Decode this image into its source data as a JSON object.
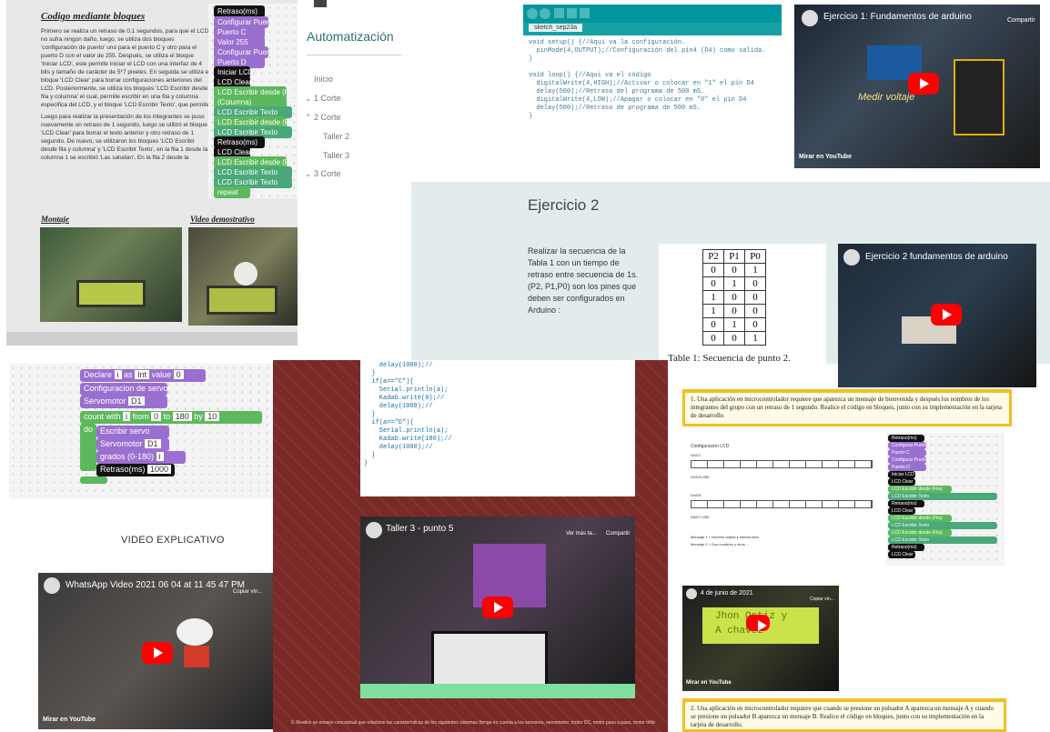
{
  "blocks_top": {
    "heading": "Codigo mediante bloques",
    "paragraph1": "Primero se realiza un retraso de 0,1 segundos, para que el LCD no sufra ningún daño, luego, se utiliza dos bloques 'configuración de puerto' uno para el puerto C y otro para el puerto D con el valor de 255. Después, se utiliza el bloque 'Iniciar LCD', este permite iniciar el LCD con una interfaz de 4 bits y tamaño de carácter de 5*7 pixeles. En seguida se utiliza el bloque 'LCD Clear' para borrar configuraciones anteriores del LCD. Posteriormente, se utiliza los bloques 'LCD Escribir desde fila y columna' el cual, permite escribir en una fila y columna especifica del LCD, y el bloque 'LCD Escribir Texto', que permite escribir texto en el LCD. En la fila 1 desde la columna 1 se escribió 'Hola' y en la fila 2 desde la columna 1 se escribió 'Bienvenidos'.",
    "paragraph2": "Luego para realizar la presentación de los integrantes se puso nuevamente un retraso de 1 segundo, luego se utilizó el bloque 'LCD Clear' para borrar el texto anterior y otro retraso de 1 segundo. De nuevo, se utilizaron los bloques 'LCD Escribir desde fila y columna' y 'LCD Escribir Texto', en la fila 1 desde la columna 1 se escribió 'Las saludan', En la fila 2 desde la columna 1 se escribió 'Darcy Vargas'. Finalmente, se utiliza el bloque de interacciones 'Repeat' y el bloque lógico 'true'.",
    "montaje": "Montaje",
    "video_demo": "Video demostrativo"
  },
  "blocks_small": [
    "Retraso(ms)",
    "Configurar Puerto",
    "Puerto C",
    "Valor 255",
    "Configurar Puerto",
    "Puerto D",
    "Valor",
    "Iniciar LCD",
    "LCD Clear",
    "LCD Escribir desde (Fila)",
    "(Columna)",
    "LCD Escribir Texto",
    "LCD Escribir desde (Fila)",
    "(Columna)",
    "LCD Escribir Texto",
    "Retraso(ms)",
    "LCD Clear",
    "Retraso(ms)",
    "LCD Escribir desde (Fila)",
    "(Columna)",
    "LCD Escribir Texto",
    "LCD Escribir desde (Fila)",
    "(Columna)",
    "LCD Escribir Texto",
    "repeat",
    "do"
  ],
  "automatizacion": {
    "title": "Automatización",
    "menu": [
      "Inicio",
      "1 Corte",
      "2 Corte",
      "Taller 2",
      "Taller 3",
      "3 Corte"
    ]
  },
  "arduino_ide": {
    "tab": "sketch_sep23a",
    "code": "void setup() {//Aqui va la configuración.\n  pinMode(4,OUTPUT);//Configuración del pin4 (D4) como salida.\n}\n\nvoid loop() {//Aqui va el código\n  digitalWrite(4,HIGH);//Activar o colocar en \"1\" el pin D4\n  delay(500);//Retraso del programa de 500 mS.\n  digitalWrite(4,LOW);//Apagar o colocar en \"0\" el pin D4\n  delay(500);//Retraso de programa de 500 mS.\n}"
  },
  "video1": {
    "title": "Ejercicio 1: Fundamentos de arduino",
    "overlay": "Medir voltaje",
    "share": "Compartir",
    "watch": "Mirar en",
    "brand": "YouTube"
  },
  "ejercicio2": {
    "heading": "Ejercicio 2",
    "text": "Realizar la secuencia de la Tabla 1 con un tiempo de retraso entre secuencia de 1s. (P2, P1,P0) son los pines que deben ser configurados en Arduino :",
    "table_headers": [
      "P2",
      "P1",
      "P0"
    ],
    "table_rows": [
      [
        "0",
        "0",
        "1"
      ],
      [
        "0",
        "1",
        "0"
      ],
      [
        "1",
        "0",
        "0"
      ],
      [
        "1",
        "0",
        "0"
      ],
      [
        "0",
        "1",
        "0"
      ],
      [
        "0",
        "0",
        "1"
      ]
    ],
    "caption": "Table 1: Secuencia de punto 2."
  },
  "video2": {
    "title": "Ejercicio 2 fundamentos de arduino"
  },
  "servo_blocks": {
    "declare": "Declare",
    "as": "as",
    "int": "Int",
    "value": "value",
    "zero": "0",
    "config": "Configuracion de servo",
    "servomotor": "Servomotor",
    "d1": "D1",
    "count": "count with",
    "from": "from",
    "to": "to",
    "by": "by",
    "from_v": "0",
    "to_v": "180",
    "by_v": "10",
    "do": "do",
    "escribir": "Escribir servo",
    "grados": "grados (0-180)",
    "retraso": "Retraso(ms)",
    "retraso_v": "1000",
    "var": "i"
  },
  "video_explicativo": "VIDEO EXPLICATIVO",
  "video3": {
    "title": "WhatsApp Video 2021 06 04 at 11 45 47 PM",
    "copy": "Copiar vín..."
  },
  "serial_code": "    delay(1000);//\n  }\n  if(a==\"C\"){\n    Serial.println(a);\n    Kadab.write(0);//\n    delay(1000);//\n  }\n  if(a==\"D\"){\n    Serial.println(a);\n    Kadab.write(180);//\n    delay(1000);//\n  }\n}",
  "video4": {
    "title": "Taller 3 - punto 5",
    "later": "Ver más ta...",
    "share": "Compartir"
  },
  "footer_red": "6. Realice un ensayo conceptual que relacione las características de los siguientes sistemas (tenga en cuenta a los sensores, servomotor, motor DC, motor paso a paso, motor trifásico).",
  "lcd_doc": {
    "q1": "1. Una aplicación en microcontrolador requiere que aparezca un mensaje de bienvenida y después los nombres de los integrantes del grupo con un retraso de 1 segundo. Realice el código en bloques, junto con su implementación en la tarjeta de desarrollo",
    "config_label": "Configuración LCD",
    "rows": [
      "D0/D1",
      "D2/D3=255",
      "D4/D5",
      "D6/D7=255"
    ],
    "msg1": "Mensaje 1 = Nombre tarjeta y bienvenidos",
    "msg2": "Mensaje 2 = Dos nombres y otros ...",
    "q2": "2. Una aplicación en microcontrolador requiere que cuando se presione un pulsador A aparezca un mensaje A y cuando se presione un pulsador B aparezca un mensaje B. Realice el código en bloques, junto con su implementación en la tarjeta de desarrollo."
  },
  "video5": {
    "title": "4 de junio de 2021",
    "copy": "Copiar vín...",
    "lcd1": "Jhon Ortiz y",
    "lcd2": "A chavez"
  },
  "colors": {
    "teal": "#0a8a8a",
    "yt_red": "#ff0000",
    "maroon": "#7a2a26",
    "yellow": "#f0c020",
    "block_purple": "#9b6fd0",
    "block_green": "#5cb85c"
  }
}
